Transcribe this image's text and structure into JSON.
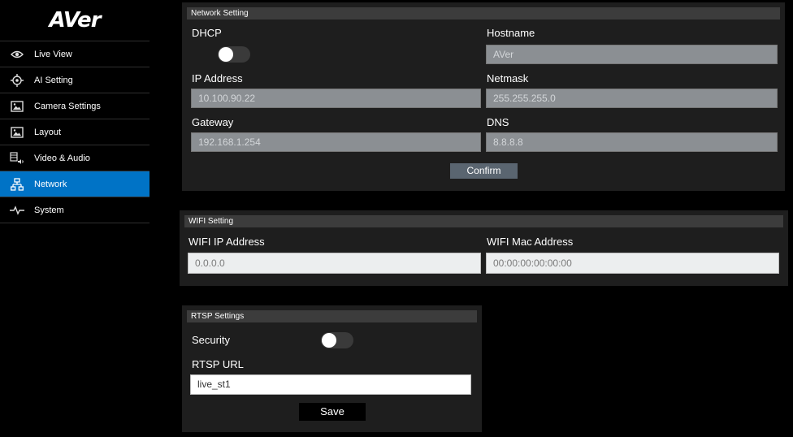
{
  "brand": {
    "logo": "AVer"
  },
  "sidebar": {
    "items": [
      {
        "label": "Live View",
        "icon": "eye-icon"
      },
      {
        "label": "AI Setting",
        "icon": "crosshair-icon"
      },
      {
        "label": "Camera Settings",
        "icon": "image-icon"
      },
      {
        "label": "Layout",
        "icon": "image-icon"
      },
      {
        "label": "Video & Audio",
        "icon": "video-audio-icon"
      },
      {
        "label": "Network",
        "icon": "network-icon",
        "active": true
      },
      {
        "label": "System",
        "icon": "pulse-icon"
      }
    ]
  },
  "network": {
    "title": "Network Setting",
    "dhcp_label": "DHCP",
    "dhcp_on": false,
    "hostname_label": "Hostname",
    "hostname_value": "AVer",
    "ip_label": "IP Address",
    "ip_value": "10.100.90.22",
    "netmask_label": "Netmask",
    "netmask_value": "255.255.255.0",
    "gateway_label": "Gateway",
    "gateway_value": "192.168.1.254",
    "dns_label": "DNS",
    "dns_value": "8.8.8.8",
    "confirm_label": "Confirm"
  },
  "wifi": {
    "title": "WIFI Setting",
    "ip_label": "WIFI IP Address",
    "ip_value": "0.0.0.0",
    "mac_label": "WIFI Mac Address",
    "mac_value": "00:00:00:00:00:00"
  },
  "rtsp": {
    "title": "RTSP Settings",
    "security_label": "Security",
    "security_on": false,
    "url_label": "RTSP URL",
    "url_value": "live_st1",
    "save_label": "Save"
  },
  "colors": {
    "accent": "#0073c6",
    "panel": "#1e1e1e",
    "header": "#3c3c3c",
    "button": "#5a6570"
  }
}
